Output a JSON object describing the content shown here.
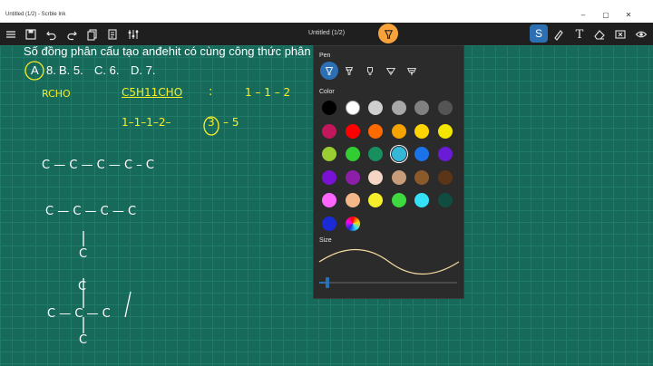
{
  "window": {
    "title": "Untitled (1/2) - Scrble Ink",
    "minimize_glyph": "–",
    "maximize_glyph": "▢",
    "close_glyph": "✕"
  },
  "toolbar": {
    "document_title": "Untitled (1/2)",
    "icons": [
      "menu-icon",
      "save-icon",
      "undo-icon",
      "redo-icon",
      "pages-icon",
      "copy-icon",
      "settings-icon",
      "pen-icon",
      "selection-icon",
      "highlighter-icon",
      "text-icon",
      "eraser-icon",
      "delete-icon",
      "view-icon"
    ],
    "selection_glyph": "S",
    "text_glyph": "T",
    "quick_colors": [
      "#ffffff",
      "#44e0c0",
      "#2ecc71",
      "#6a0dad",
      "#ffffff"
    ]
  },
  "canvas": {
    "background": "#17695a",
    "question_line": "Số đồng phân cấu tạo anđehit có cùng công thức phân",
    "answers": [
      "A",
      "8.",
      "B. 5.",
      "C. 6.",
      "D. 7."
    ],
    "handwriting": {
      "rcho": "RCHO",
      "formula": "C5H11CHO",
      "colon": ":",
      "ratio_top": "1 – 1 – 2",
      "ratio_line": "1–1–1–2–",
      "circled": "3",
      "ratio_end": "– 5",
      "chain1": "C — C — C — C  –  C",
      "chain2": "C — C — C — C",
      "branch_c": "C",
      "chain3_top": "C",
      "chain3_mid": "C — C — C",
      "chain3_bottom": "C"
    }
  },
  "pen_panel": {
    "pen_label": "Pen",
    "color_label": "Color",
    "size_label": "Size",
    "pen_types": [
      "ballpoint-pen-icon",
      "fine-pen-icon",
      "marker-pen-icon",
      "brush-pen-icon",
      "calligraphy-pen-icon"
    ],
    "selected_pen_type": 0,
    "colors": [
      [
        "#000000",
        "#ffffff",
        "#cfcfcf",
        "#a8a8a8",
        "#808080",
        "#555555"
      ],
      [
        "#c2185b",
        "#ff0000",
        "#ff6a00",
        "#f4a300",
        "#ffd400",
        "#f2e600"
      ],
      [
        "#9acd32",
        "#32cd32",
        "#178f5e",
        "#35b8d8",
        "#1a73e8",
        "#6a1bd6"
      ],
      [
        "#7a12d6",
        "#8b1fa8",
        "#f5d6c6",
        "#c69c7a",
        "#8b5a2b",
        "#5a3518"
      ],
      [
        "#ff66ff",
        "#f3b78a",
        "#f6ef2a",
        "#3fd83f",
        "#33e0f5",
        "#104d40"
      ],
      [
        "#1a2bd6",
        "gradient"
      ]
    ],
    "selected_color": "#35b8d8",
    "size_value": 0.05
  }
}
